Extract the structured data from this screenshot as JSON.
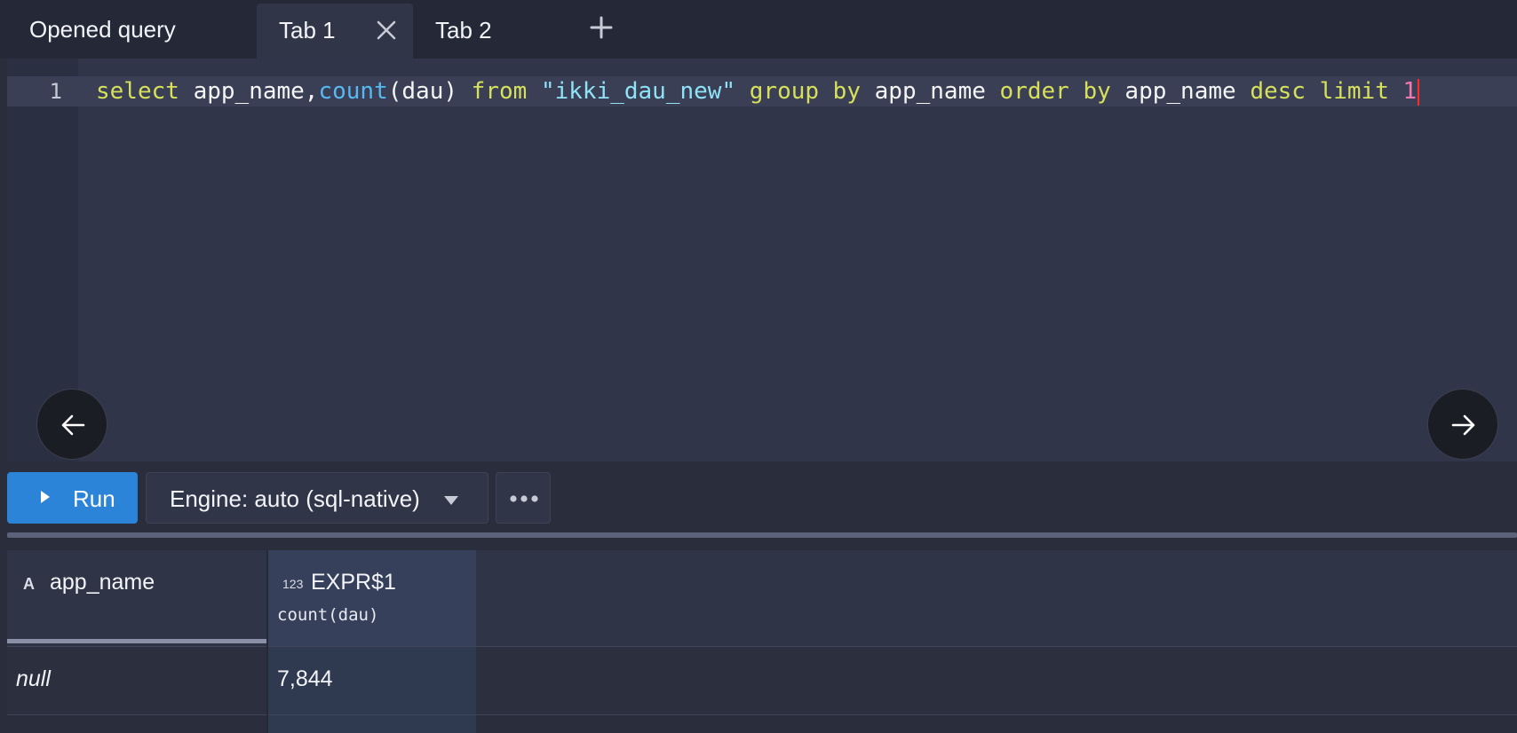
{
  "tabs": {
    "opened_query_label": "Opened query",
    "items": [
      {
        "label": "Tab 1",
        "active": true
      },
      {
        "label": "Tab 2",
        "active": false
      }
    ],
    "add_icon": "plus-icon",
    "close_icon": "close-icon"
  },
  "editor": {
    "line_number": "1",
    "tokens": [
      {
        "t": "kw",
        "v": "select"
      },
      {
        "t": "id",
        "v": " app_name,"
      },
      {
        "t": "fn",
        "v": "count"
      },
      {
        "t": "id",
        "v": "(dau) "
      },
      {
        "t": "kw",
        "v": "from"
      },
      {
        "t": "id",
        "v": " "
      },
      {
        "t": "str",
        "v": "\"ikki_dau_new\""
      },
      {
        "t": "id",
        "v": " "
      },
      {
        "t": "kw",
        "v": "group by"
      },
      {
        "t": "id",
        "v": " app_name "
      },
      {
        "t": "kw",
        "v": "order by"
      },
      {
        "t": "id",
        "v": " app_name "
      },
      {
        "t": "kw",
        "v": "desc limit"
      },
      {
        "t": "id",
        "v": " "
      },
      {
        "t": "num",
        "v": "1"
      }
    ],
    "nav_left_icon": "arrow-left-icon",
    "nav_right_icon": "arrow-right-icon"
  },
  "toolbar": {
    "run_label": "Run",
    "engine_label": "Engine: auto (sql-native)",
    "more_icon": "more-horizontal-icon"
  },
  "results": {
    "columns": [
      {
        "type_badge": "A",
        "name": "app_name",
        "expr": ""
      },
      {
        "type_badge": "123",
        "name": "EXPR$1",
        "expr": "count(dau)"
      }
    ],
    "rows": [
      [
        "null",
        "7,844"
      ]
    ]
  },
  "colors": {
    "accent": "#2c84d8",
    "keyword": "#d6e05b",
    "function": "#57b8f2",
    "string": "#8fe3f7",
    "number": "#f07ab0",
    "cursor": "#ff2a2a"
  }
}
